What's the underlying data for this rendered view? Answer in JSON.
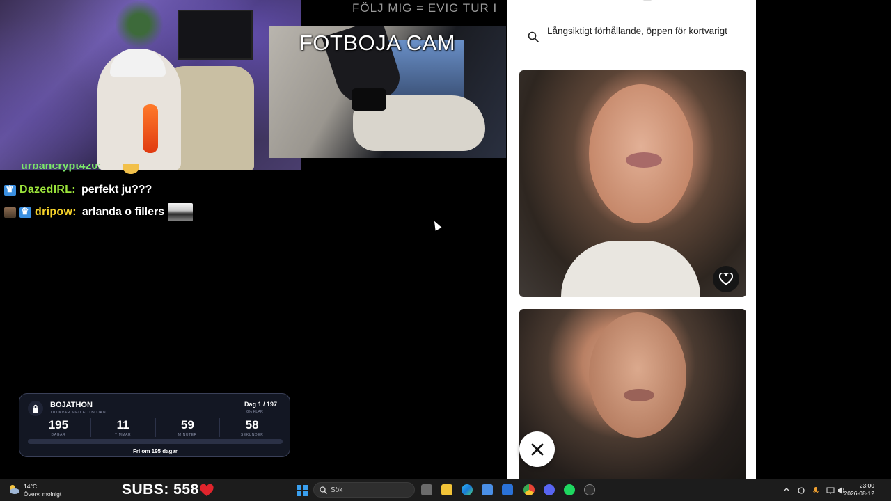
{
  "stream": {
    "follow_banner": "FÖLJ MIG = EVIG TUR I",
    "footcam_title": "FOTBOJA CAM",
    "subs_label": "SUBS: 558"
  },
  "chat": {
    "partial_user": "urbancrypt420:",
    "messages": [
      {
        "user": "DazedIRL:",
        "user_color": "#9be33b",
        "text": "perfekt ju???"
      },
      {
        "user": "dripow:",
        "user_color": "#f5d22a",
        "text": "arlanda o fillers"
      }
    ]
  },
  "countdown": {
    "title": "BOJATHON",
    "subtitle": "TID KVAR MED FOTBOJAN",
    "day_label": "Dag 1 / 197",
    "percent_label": "0% KLAR",
    "progress_fraction": 0.0,
    "cells": [
      {
        "value": "195",
        "unit": "DAGAR"
      },
      {
        "value": "11",
        "unit": "TIMMAR"
      },
      {
        "value": "59",
        "unit": "MINUTER"
      },
      {
        "value": "58",
        "unit": "SEKUNDER"
      }
    ],
    "footer": "Fri om 195 dagar"
  },
  "dating_app": {
    "search_text": "Långsiktigt förhållande, öppen för kortvarigt",
    "like_icon": "heart-outline-icon",
    "close_icon": "close-icon"
  },
  "taskbar": {
    "weather_temp": "14°C",
    "weather_desc": "Överv. molnigt",
    "search_placeholder": "Sök",
    "time": "23:00",
    "date": "2026-08-12",
    "accent": "#3aa0f0"
  }
}
